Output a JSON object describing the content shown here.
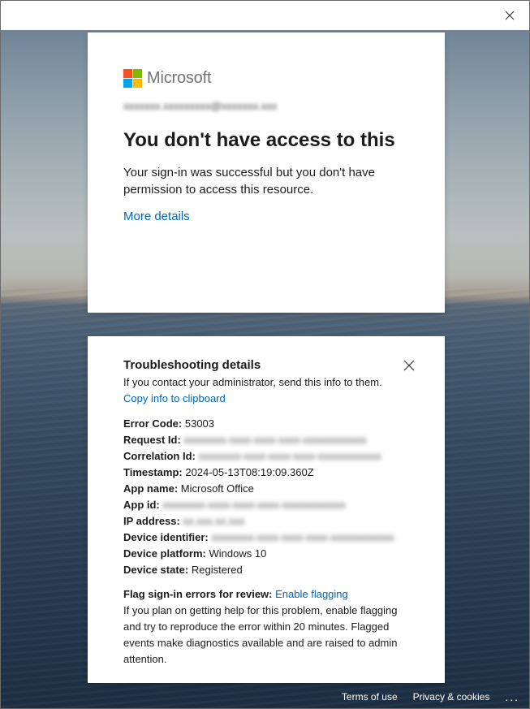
{
  "window": {
    "close_icon": "close-icon"
  },
  "signin_card": {
    "brand": "Microsoft",
    "account": "xxxxxxx.xxxxxxxxx@xxxxxxx.xxx",
    "title": "You don't have access to this",
    "message": "Your sign-in was successful but you don't have permission to access this resource.",
    "more_details": "More details"
  },
  "details_card": {
    "title": "Troubleshooting details",
    "subtitle": "If you contact your administrator, send this info to them.",
    "copy_link": "Copy info to clipboard",
    "fields": [
      {
        "label": "Error Code:",
        "value": "53003",
        "blurred": false
      },
      {
        "label": "Request Id:",
        "value": "xxxxxxxx-xxxx-xxxx-xxxx-xxxxxxxxxxxx",
        "blurred": true
      },
      {
        "label": "Correlation Id:",
        "value": "xxxxxxxx-xxxx-xxxx-xxxx-xxxxxxxxxxxx",
        "blurred": true
      },
      {
        "label": "Timestamp:",
        "value": "2024-05-13T08:19:09.360Z",
        "blurred": false
      },
      {
        "label": "App name:",
        "value": "Microsoft Office",
        "blurred": false
      },
      {
        "label": "App id:",
        "value": "xxxxxxxx-xxxx-xxxx-xxxx-xxxxxxxxxxxx",
        "blurred": true
      },
      {
        "label": "IP address:",
        "value": "xx.xxx.xx.xxx",
        "blurred": true
      },
      {
        "label": "Device identifier:",
        "value": "xxxxxxxx-xxxx-xxxx-xxxx-xxxxxxxxxxxx",
        "blurred": true
      },
      {
        "label": "Device platform:",
        "value": "Windows 10",
        "blurred": false
      },
      {
        "label": "Device state:",
        "value": "Registered",
        "blurred": false
      }
    ],
    "flag_label": "Flag sign-in errors for review:",
    "flag_link": "Enable flagging",
    "flag_text": "If you plan on getting help for this problem, enable flagging and try to reproduce the error within 20 minutes. Flagged events make diagnostics available and are raised to admin attention."
  },
  "footer": {
    "terms": "Terms of use",
    "privacy": "Privacy & cookies",
    "more": "..."
  },
  "colors": {
    "link": "#0067b8",
    "ms_red": "#f25022",
    "ms_green": "#7fba00",
    "ms_blue": "#00a4ef",
    "ms_yellow": "#ffb900"
  }
}
